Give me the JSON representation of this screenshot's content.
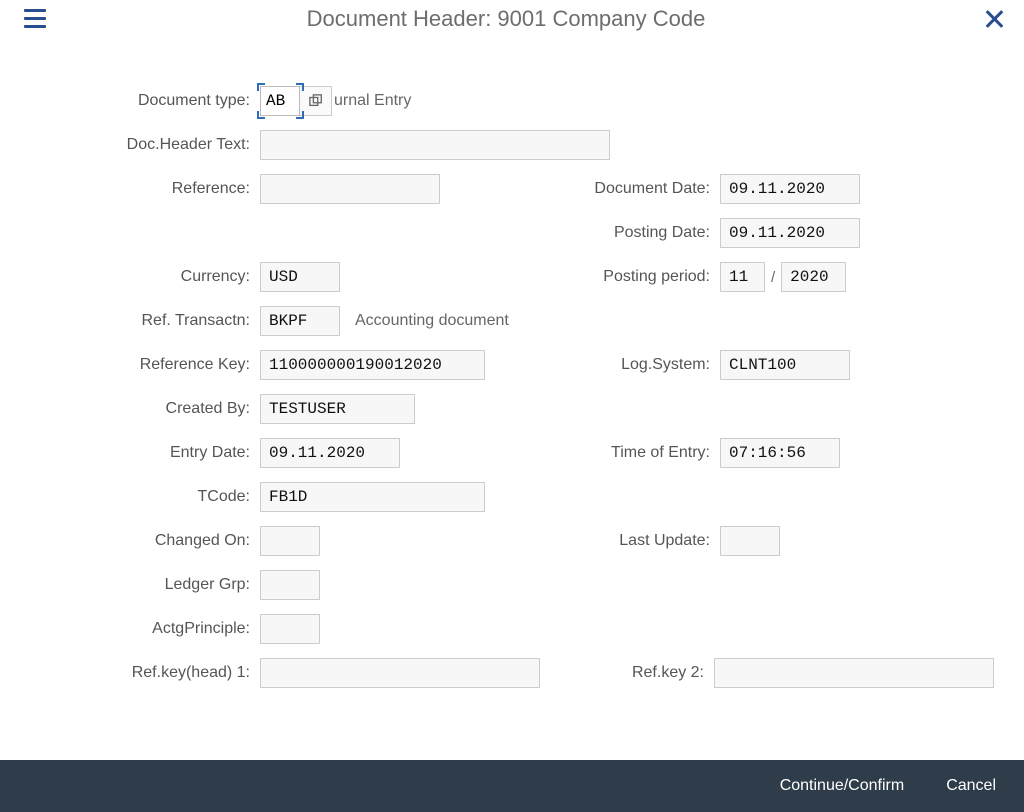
{
  "header": {
    "title": "Document Header: 9001 Company Code"
  },
  "labels": {
    "document_type": "Document type:",
    "doc_header_text": "Doc.Header Text:",
    "reference": "Reference:",
    "document_date": "Document Date:",
    "posting_date": "Posting Date:",
    "currency": "Currency:",
    "posting_period": "Posting period:",
    "ref_transactn": "Ref. Transactn:",
    "reference_key": "Reference Key:",
    "log_system": "Log.System:",
    "created_by": "Created By:",
    "entry_date": "Entry Date:",
    "time_of_entry": "Time of Entry:",
    "tcode": "TCode:",
    "changed_on": "Changed On:",
    "last_update": "Last Update:",
    "ledger_grp": "Ledger Grp:",
    "actg_principle": "ActgPrinciple:",
    "ref_key_head_1": "Ref.key(head) 1:",
    "ref_key_2": "Ref.key 2:"
  },
  "values": {
    "document_type": "AB",
    "document_type_desc": "urnal Entry",
    "doc_header_text": "",
    "reference": "",
    "document_date": "09.11.2020",
    "posting_date": "09.11.2020",
    "currency": "USD",
    "posting_period_month": "11",
    "posting_period_year": "2020",
    "ref_transactn": "BKPF",
    "ref_transactn_desc": "Accounting document",
    "reference_key": "110000000190012020",
    "log_system": "CLNT100",
    "created_by": "TESTUSER",
    "entry_date": "09.11.2020",
    "time_of_entry": "07:16:56",
    "tcode": "FB1D",
    "changed_on": "",
    "last_update": "",
    "ledger_grp": "",
    "actg_principle": "",
    "ref_key_head_1": "",
    "ref_key_2": ""
  },
  "footer": {
    "continue": "Continue/Confirm",
    "cancel": "Cancel"
  }
}
